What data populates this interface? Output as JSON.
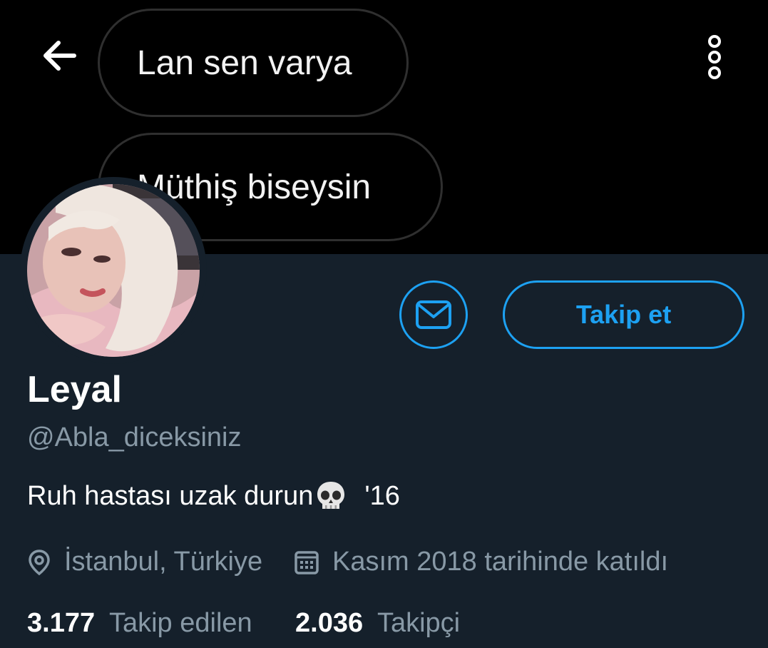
{
  "banner": {
    "bubbles": [
      "Lan sen varya",
      "Müthiş biseysin"
    ]
  },
  "header": {
    "back_icon": "arrow-left-icon",
    "more_icon": "vertical-dots-icon"
  },
  "profile": {
    "name": "Leyal",
    "handle": "@Abla_diceksiniz",
    "bio_text": "Ruh hastası uzak durun",
    "bio_emoji": "skull-icon",
    "bio_year": "'16",
    "location": "İstanbul, Türkiye",
    "joined": "Kasım 2018 tarihinde katıldı",
    "following_count": "3.177",
    "following_label": "Takip edilen",
    "followers_count": "2.036",
    "followers_label": "Takipçi"
  },
  "actions": {
    "message_icon": "envelope-icon",
    "follow_label": "Takip et"
  },
  "colors": {
    "accent": "#1da1f2",
    "background": "#15202b",
    "secondary_text": "#8899a6",
    "banner": "#000000"
  }
}
